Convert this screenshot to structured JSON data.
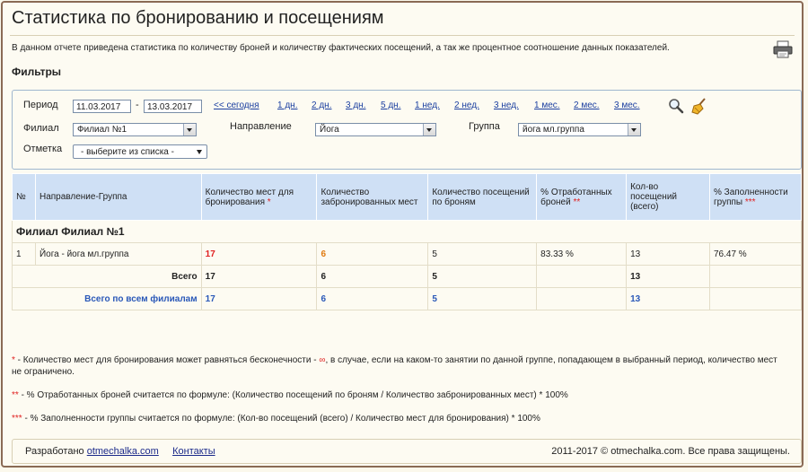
{
  "page": {
    "title": "Статистика по бронированию и посещениям",
    "description": "В данном отчете приведена статистика по количеству броней и количеству фактических посещений, а так же процентное соотношение данных показателей.",
    "filters_heading": "Фильтры"
  },
  "filters": {
    "period_label": "Период",
    "date_from": "11.03.2017",
    "date_sep": "-",
    "date_to": "13.03.2017",
    "quick_links": [
      "<< сегодня",
      "1 дн.",
      "2 дн.",
      "3 дн.",
      "5 дн.",
      "1 нед.",
      "2 нед.",
      "3 нед.",
      "1 мес.",
      "2 мес.",
      "3 мес."
    ],
    "branch_label": "Филиал",
    "branch_value": "Филиал №1",
    "direction_label": "Направление",
    "direction_value": "Йога",
    "group_label": "Группа",
    "group_value": "йога мл.группа",
    "mark_label": "Отметка",
    "mark_value": "- выберите из списка -",
    "icons": [
      "search-icon",
      "broom-icon"
    ]
  },
  "table": {
    "headers": {
      "num": "№",
      "direction_group": "Направление-Группа",
      "places": "Количество мест для бронирования",
      "places_mark": "*",
      "booked": "Количество забронированных мест",
      "visits_by_booking": "Количество посещений по броням",
      "pct_worked": "% Отработанных броней",
      "pct_worked_mark": "**",
      "visits_total": "Кол-во посещений (всего)",
      "pct_fill": "% Заполненности группы",
      "pct_fill_mark": "***"
    },
    "branch_title": "Филиал Филиал №1",
    "rows": [
      {
        "num": "1",
        "name": "Йога - йога мл.группа",
        "places": "17",
        "booked": "6",
        "visits": "5",
        "pct_worked": "83.33 %",
        "visits_total": "13",
        "pct_fill": "76.47 %"
      }
    ],
    "total": {
      "label": "Всего",
      "places": "17",
      "booked": "6",
      "visits": "5",
      "visits_total": "13"
    },
    "grand_total": {
      "label": "Всего по всем филиалам",
      "places": "17",
      "booked": "6",
      "visits": "5",
      "visits_total": "13"
    }
  },
  "notes": {
    "n1_mark": "*",
    "n1_a": " - Количество мест для бронирования может равняться бесконечности - ",
    "n1_inf": "∞",
    "n1_b": ", в случае, если на каком-то занятии по данной группе, попадающем в выбранный период, количество мест не ограничено.",
    "n2_mark": "**",
    "n2": " - % Отработанных броней считается по формуле: (Количество посещений по броням / Количество забронированных мест) * 100%",
    "n3_mark": "***",
    "n3": " - % Заполненности группы считается по формуле: (Кол-во посещений (всего) / Количество мест для бронирования) * 100%"
  },
  "footer": {
    "developed_by": "Разработано",
    "site_link": "otmechalka.com",
    "contacts": "Контакты",
    "copyright": "2011-2017 © otmechalka.com. Все права защищены."
  }
}
